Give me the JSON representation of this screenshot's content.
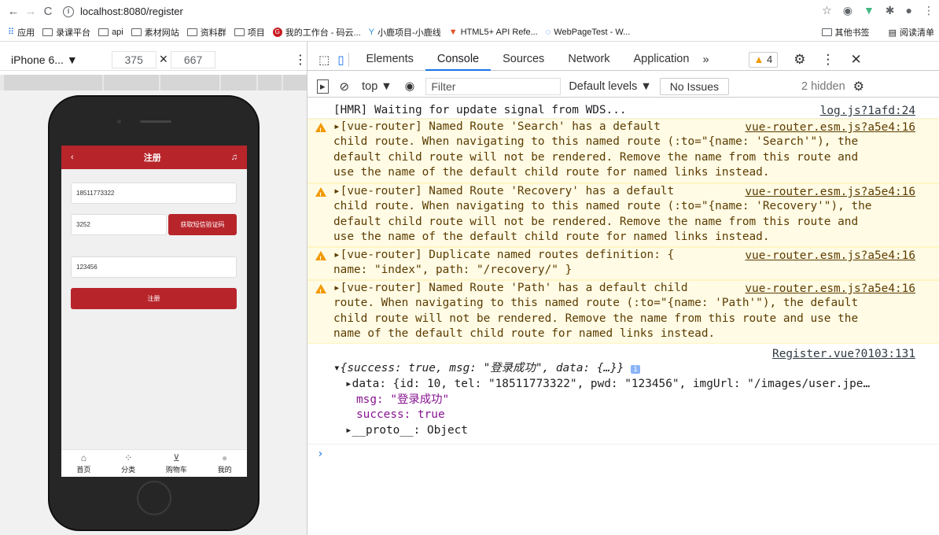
{
  "browser": {
    "url": "localhost:8080/register",
    "bookmarks": [
      "应用",
      "录课平台",
      "api",
      "素材网站",
      "资料群",
      "项目",
      "我的工作台 - 码云...",
      "小鹿项目-小鹿线",
      "HTML5+ API Refe...",
      "WebPageTest - W..."
    ],
    "bookmarks_right": [
      "其他书签",
      "阅读清单"
    ]
  },
  "device": {
    "name": "iPhone 6...",
    "width": "375",
    "height": "667",
    "times": "×"
  },
  "app": {
    "header_title": "注册",
    "phone_value": "18511773322",
    "code_value": "3252",
    "sms_button": "获取短信验证码",
    "password_value": "123456",
    "register_button": "注册",
    "tabs": [
      "首页",
      "分类",
      "购物车",
      "我的"
    ]
  },
  "devtools": {
    "tabs": [
      "Elements",
      "Console",
      "Sources",
      "Network",
      "Application"
    ],
    "more": "»",
    "warning_count": "4",
    "context": "top ▼",
    "filter_placeholder": "Filter",
    "levels": "Default levels ▼",
    "issues": "No Issues",
    "hidden": "2 hidden"
  },
  "console": {
    "hmr": {
      "text": "[HMR] Waiting for update signal from WDS...",
      "source": "log.js?1afd:24"
    },
    "warnings": [
      {
        "text": "▸[vue-router] Named Route 'Search' has a default\nchild route. When navigating to this named route (:to=\"{name: 'Search'\"), the\ndefault child route will not be rendered. Remove the name from this route and\nuse the name of the default child route for named links instead.",
        "source": "vue-router.esm.js?a5e4:16"
      },
      {
        "text": "▸[vue-router] Named Route 'Recovery' has a default\nchild route. When navigating to this named route (:to=\"{name: 'Recovery'\"), the\ndefault child route will not be rendered. Remove the name from this route and\nuse the name of the default child route for named links instead.",
        "source": "vue-router.esm.js?a5e4:16"
      },
      {
        "text": "▸[vue-router] Duplicate named routes definition: {\nname: \"index\", path: \"/recovery/\" }",
        "source": "vue-router.esm.js?a5e4:16"
      },
      {
        "text": "▸[vue-router] Named Route 'Path' has a default child\nroute. When navigating to this named route (:to=\"{name: 'Path'\"), the default\nchild route will not be rendered. Remove the name from this route and use the\nname of the default child route for named links instead.",
        "source": "vue-router.esm.js?a5e4:16"
      }
    ],
    "log_source": "Register.vue?0103:131",
    "object_summary": "{success: true, msg: \"登录成功\", data: {…}}",
    "data_line": "data: {id: 10, tel: \"18511773322\", pwd: \"123456\", imgUrl: \"/images/user.jpe…",
    "msg_line": "msg: \"登录成功\"",
    "success_line": "success: true",
    "proto_line": "__proto__: Object",
    "prompt": "›"
  },
  "colors": {
    "brand": "#b7252b",
    "warn_bg": "#fffbe5",
    "warn_icon": "#f29900",
    "accent": "#1a73e8"
  }
}
